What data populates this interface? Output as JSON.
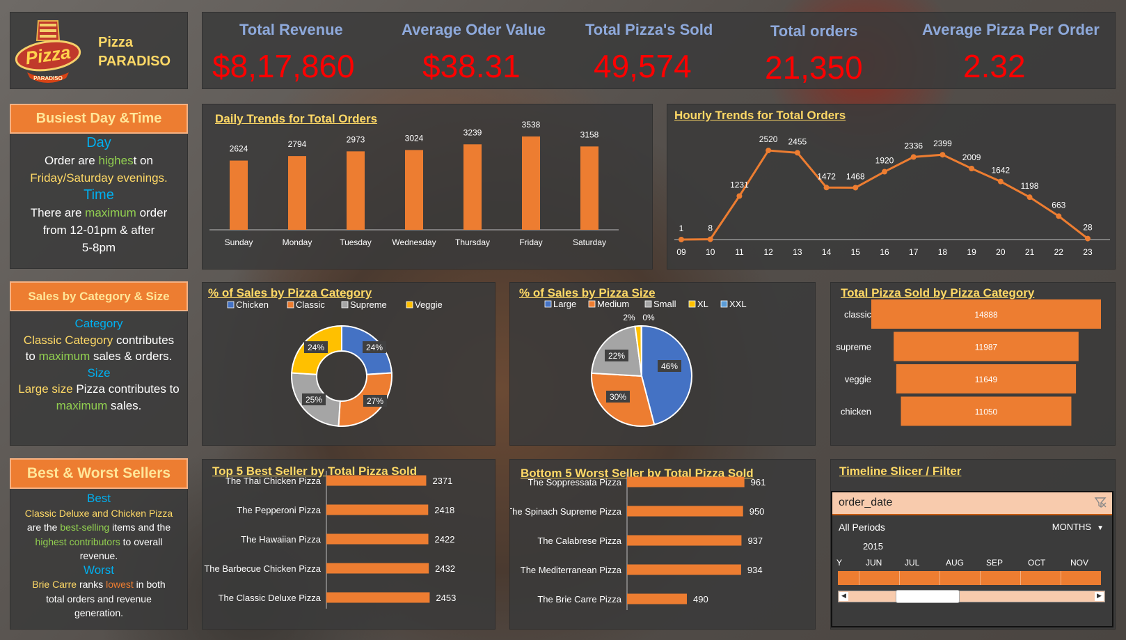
{
  "brand": {
    "name_line1": "Pizza",
    "name_line2": "PARADISO",
    "logo_text": "Pizza",
    "logo_sub": "PARADISO"
  },
  "kpis": [
    {
      "title": "Total Revenue",
      "value": "$8,17,860"
    },
    {
      "title": "Average Oder Value",
      "value": "$38.31"
    },
    {
      "title": "Total Pizza's Sold",
      "value": "49,574"
    },
    {
      "title": "Total orders",
      "value": "21,350"
    },
    {
      "title": "Average Pizza Per Order",
      "value": "2.32"
    }
  ],
  "busiest": {
    "header": "Busiest Day &Time",
    "day_heading": "Day",
    "day_text_a": "Order are ",
    "day_text_hl": "highes",
    "day_text_b": "t on",
    "day_text_c": "Friday/Saturday evenings.",
    "time_heading": "Time",
    "time_text_a": "There are ",
    "time_text_hl": "maximum",
    "time_text_b": " order",
    "time_text_c": "from 12-01pm & after",
    "time_text_d": "5-8pm"
  },
  "sales_cat_size": {
    "header": "Sales by Category & Size",
    "cat_heading": "Category",
    "cat_a_hl": "Classic Category",
    "cat_a": " contributes",
    "cat_b": "to ",
    "cat_b_hl": "maximum",
    "cat_b2": " sales & orders.",
    "size_heading": "Size",
    "size_a_hl": "Large size",
    "size_a": " Pizza contributes to",
    "size_b_hl": "maximum",
    "size_b": " sales."
  },
  "best_worst": {
    "header": "Best & Worst Sellers",
    "best_heading": "Best",
    "best_a_hl": "Classic Deluxe and Chicken Pizza",
    "best_b": "are the ",
    "best_b_hl": "best-selling",
    "best_b2": " items and the",
    "best_c_hl": "highest contributors",
    "best_c": " to overall",
    "best_d": "revenue.",
    "worst_heading": "Worst",
    "worst_a_hl": "Brie Carre",
    "worst_a": " ranks ",
    "worst_a_hl2": "lowest",
    "worst_a2": " in both",
    "worst_b": "total orders and revenue",
    "worst_c": "generation."
  },
  "daily_chart": {
    "title": "Daily Trends for Total Orders",
    "type": "bar",
    "categories": [
      "Sunday",
      "Monday",
      "Tuesday",
      "Wednesday",
      "Thursday",
      "Friday",
      "Saturday"
    ],
    "values": [
      2624,
      2794,
      2973,
      3024,
      3239,
      3538,
      3158
    ],
    "color": "#ed7d31"
  },
  "hourly_chart": {
    "title": "Hourly Trends for Total Orders",
    "type": "line",
    "categories": [
      "09",
      "10",
      "11",
      "12",
      "13",
      "14",
      "15",
      "16",
      "17",
      "18",
      "19",
      "20",
      "21",
      "22",
      "23"
    ],
    "values": [
      1,
      8,
      1231,
      2520,
      2455,
      1472,
      1468,
      1920,
      2336,
      2399,
      2009,
      1642,
      1198,
      663,
      28
    ],
    "color": "#ed7d31"
  },
  "category_pie": {
    "title": "% of Sales by Pizza Category",
    "type": "pie",
    "legend": [
      "Chicken",
      "Classic",
      "Supreme",
      "Veggie"
    ],
    "labels": [
      "24%",
      "27%",
      "25%",
      "24%"
    ],
    "values": [
      24,
      27,
      25,
      24
    ],
    "colors": [
      "#4472c4",
      "#ed7d31",
      "#a5a5a5",
      "#ffc000"
    ]
  },
  "size_pie": {
    "title": "% of Sales by Pizza Size",
    "type": "pie",
    "legend": [
      "Large",
      "Medium",
      "Small",
      "XL",
      "XXL"
    ],
    "labels": [
      "46%",
      "30%",
      "22%",
      "2%",
      "0%"
    ],
    "values": [
      46,
      30,
      22,
      2,
      0.1
    ],
    "colors": [
      "#4472c4",
      "#ed7d31",
      "#a5a5a5",
      "#ffc000",
      "#5b9bd5"
    ]
  },
  "category_sold": {
    "title": "Total Pizza Sold by Pizza Category",
    "type": "bar",
    "categories": [
      "classic",
      "supreme",
      "veggie",
      "chicken"
    ],
    "values": [
      14888,
      11987,
      11649,
      11050
    ]
  },
  "top5": {
    "title": "Top 5 Best Seller by Total Pizza Sold",
    "type": "bar",
    "categories": [
      "The Thai Chicken Pizza",
      "The Pepperoni Pizza",
      "The Hawaiian Pizza",
      "The Barbecue Chicken Pizza",
      "The Classic Deluxe Pizza"
    ],
    "values": [
      2371,
      2418,
      2422,
      2432,
      2453
    ]
  },
  "bottom5": {
    "title": "Bottom 5 Worst Seller by Total Pizza Sold",
    "type": "bar",
    "categories": [
      "The Soppressata Pizza",
      "The Spinach Supreme Pizza",
      "The Calabrese Pizza",
      "The Mediterranean Pizza",
      "The Brie Carre Pizza"
    ],
    "values": [
      961,
      950,
      937,
      934,
      490
    ]
  },
  "timeline": {
    "title": "Timeline Slicer / Filter",
    "field": "order_date",
    "periods": "All Periods",
    "unit": "MONTHS",
    "year": "2015",
    "months": [
      "Y",
      "JUN",
      "JUL",
      "AUG",
      "SEP",
      "OCT",
      "NOV"
    ]
  },
  "chart_data": [
    {
      "type": "bar",
      "title": "Daily Trends for Total Orders",
      "categories": [
        "Sunday",
        "Monday",
        "Tuesday",
        "Wednesday",
        "Thursday",
        "Friday",
        "Saturday"
      ],
      "values": [
        2624,
        2794,
        2973,
        3024,
        3239,
        3538,
        3158
      ]
    },
    {
      "type": "line",
      "title": "Hourly Trends for Total Orders",
      "x": [
        "09",
        "10",
        "11",
        "12",
        "13",
        "14",
        "15",
        "16",
        "17",
        "18",
        "19",
        "20",
        "21",
        "22",
        "23"
      ],
      "values": [
        1,
        8,
        1231,
        2520,
        2455,
        1472,
        1468,
        1920,
        2336,
        2399,
        2009,
        1642,
        1198,
        663,
        28
      ]
    },
    {
      "type": "pie",
      "title": "% of Sales by Pizza Category",
      "categories": [
        "Chicken",
        "Classic",
        "Supreme",
        "Veggie"
      ],
      "values": [
        24,
        27,
        25,
        24
      ]
    },
    {
      "type": "pie",
      "title": "% of Sales by Pizza Size",
      "categories": [
        "Large",
        "Medium",
        "Small",
        "XL",
        "XXL"
      ],
      "values": [
        46,
        30,
        22,
        2,
        0
      ]
    },
    {
      "type": "bar",
      "title": "Total Pizza Sold by Pizza Category",
      "categories": [
        "classic",
        "supreme",
        "veggie",
        "chicken"
      ],
      "values": [
        14888,
        11987,
        11649,
        11050
      ]
    },
    {
      "type": "bar",
      "title": "Top 5 Best Seller by Total Pizza Sold",
      "categories": [
        "The Thai Chicken Pizza",
        "The Pepperoni Pizza",
        "The Hawaiian Pizza",
        "The Barbecue Chicken Pizza",
        "The Classic Deluxe Pizza"
      ],
      "values": [
        2371,
        2418,
        2422,
        2432,
        2453
      ]
    },
    {
      "type": "bar",
      "title": "Bottom 5 Worst Seller by Total Pizza Sold",
      "categories": [
        "The Soppressata Pizza",
        "The Spinach Supreme Pizza",
        "The Calabrese Pizza",
        "The Mediterranean Pizza",
        "The Brie Carre Pizza"
      ],
      "values": [
        961,
        950,
        937,
        934,
        490
      ]
    }
  ]
}
